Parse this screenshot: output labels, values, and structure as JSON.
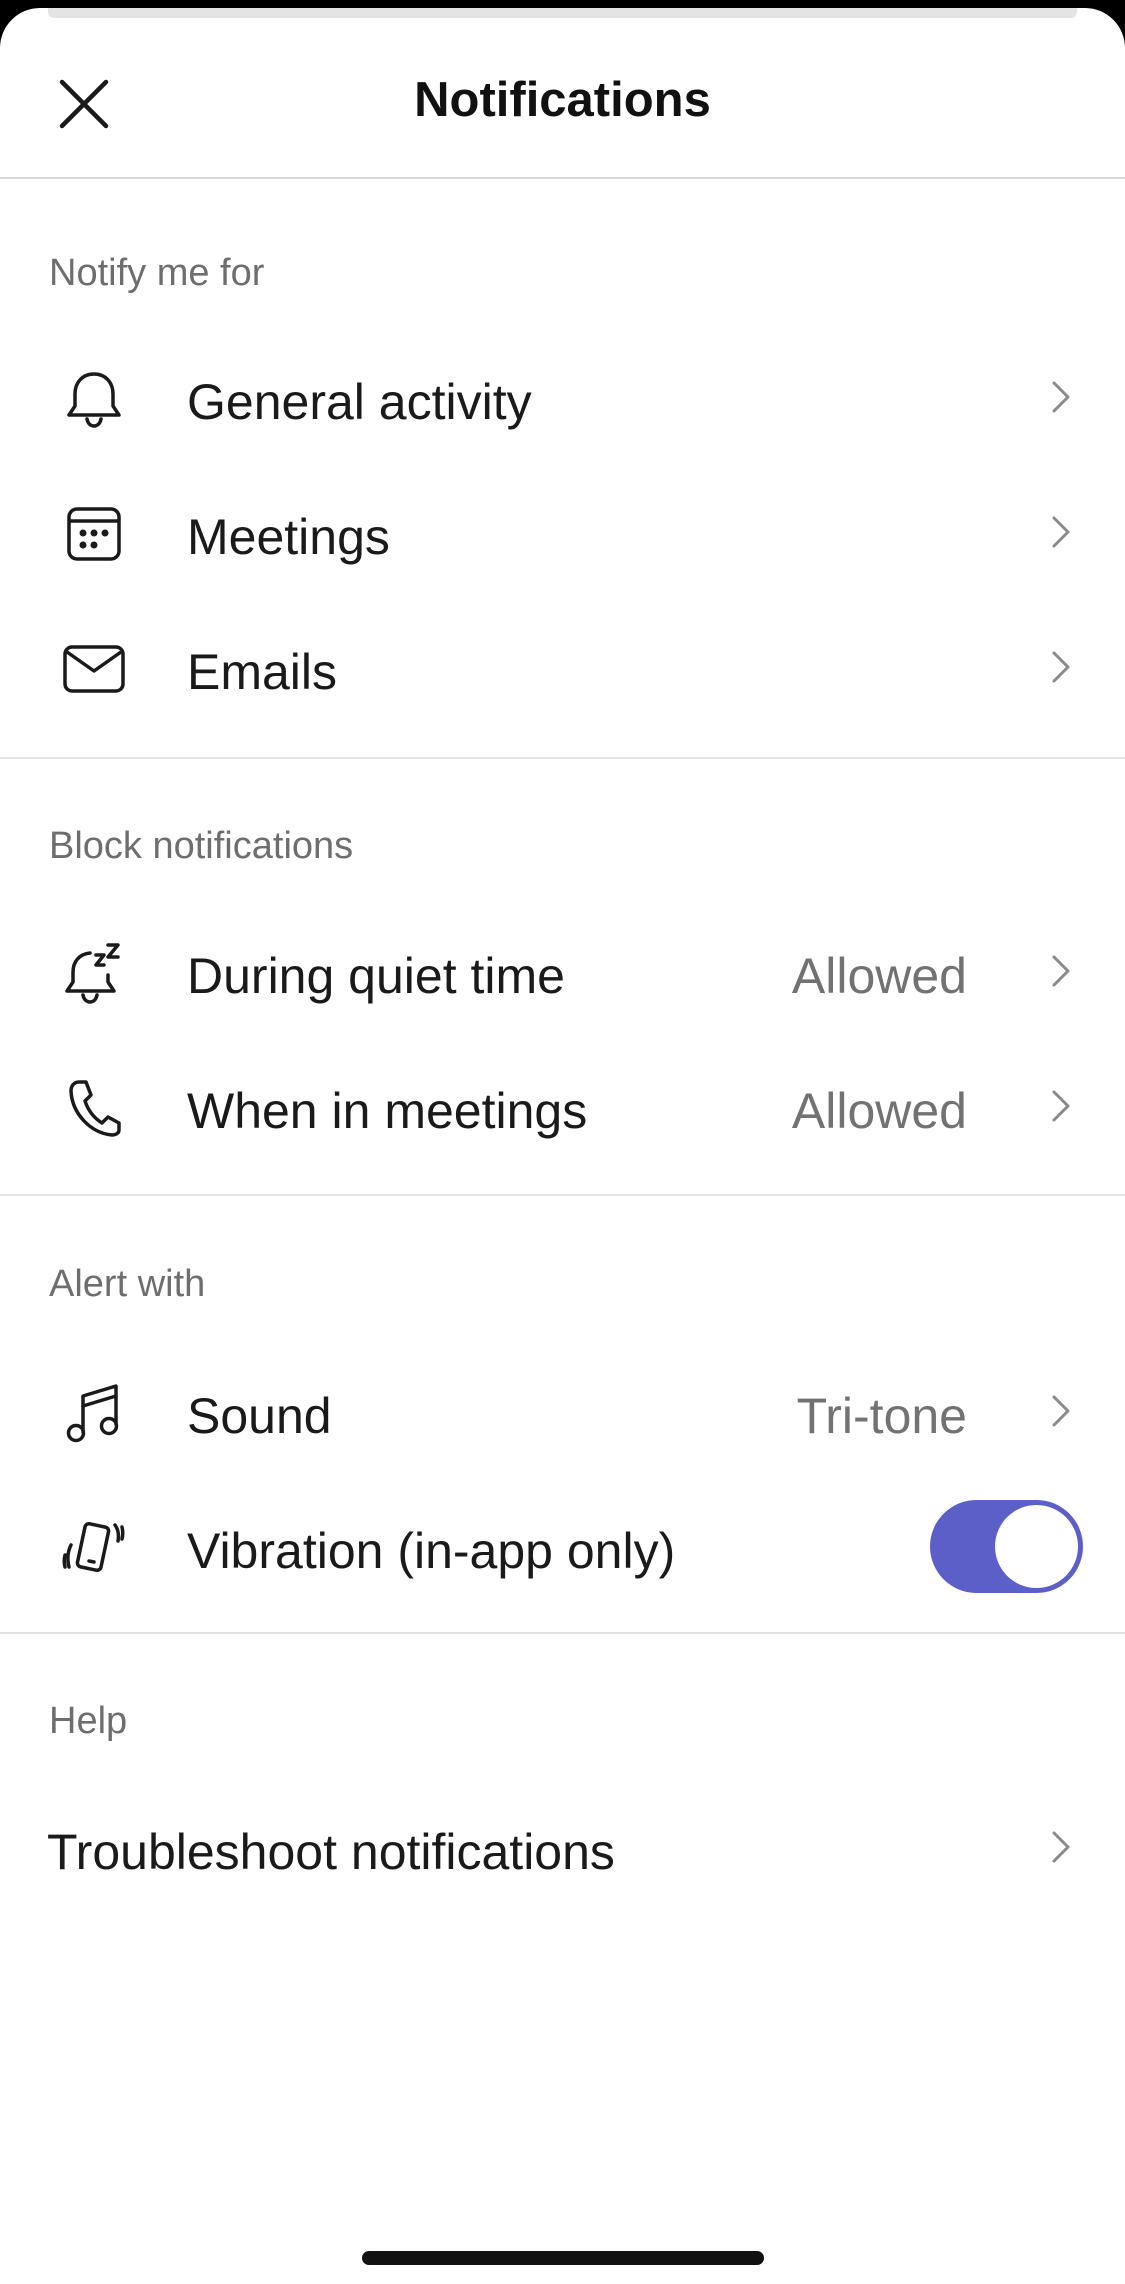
{
  "header": {
    "title": "Notifications",
    "close_icon": "close-icon"
  },
  "sections": {
    "notify": {
      "label": "Notify me for",
      "items": [
        {
          "label": "General activity",
          "icon": "bell-icon"
        },
        {
          "label": "Meetings",
          "icon": "calendar-icon"
        },
        {
          "label": "Emails",
          "icon": "mail-icon"
        }
      ]
    },
    "block": {
      "label": "Block notifications",
      "items": [
        {
          "label": "During quiet time",
          "value": "Allowed",
          "icon": "bell-snooze-icon"
        },
        {
          "label": "When in meetings",
          "value": "Allowed",
          "icon": "phone-icon"
        }
      ]
    },
    "alert": {
      "label": "Alert with",
      "items": [
        {
          "label": "Sound",
          "value": "Tri-tone",
          "icon": "music-note-icon"
        },
        {
          "label": "Vibration (in-app only)",
          "toggle_on": true,
          "icon": "vibrate-icon"
        }
      ]
    },
    "help": {
      "label": "Help",
      "items": [
        {
          "label": "Troubleshoot notifications"
        }
      ]
    }
  },
  "colors": {
    "accent": "#5b5fc7",
    "text": "#1a1a1a",
    "secondary_text": "#727272",
    "section_label": "#6e6e6e"
  }
}
